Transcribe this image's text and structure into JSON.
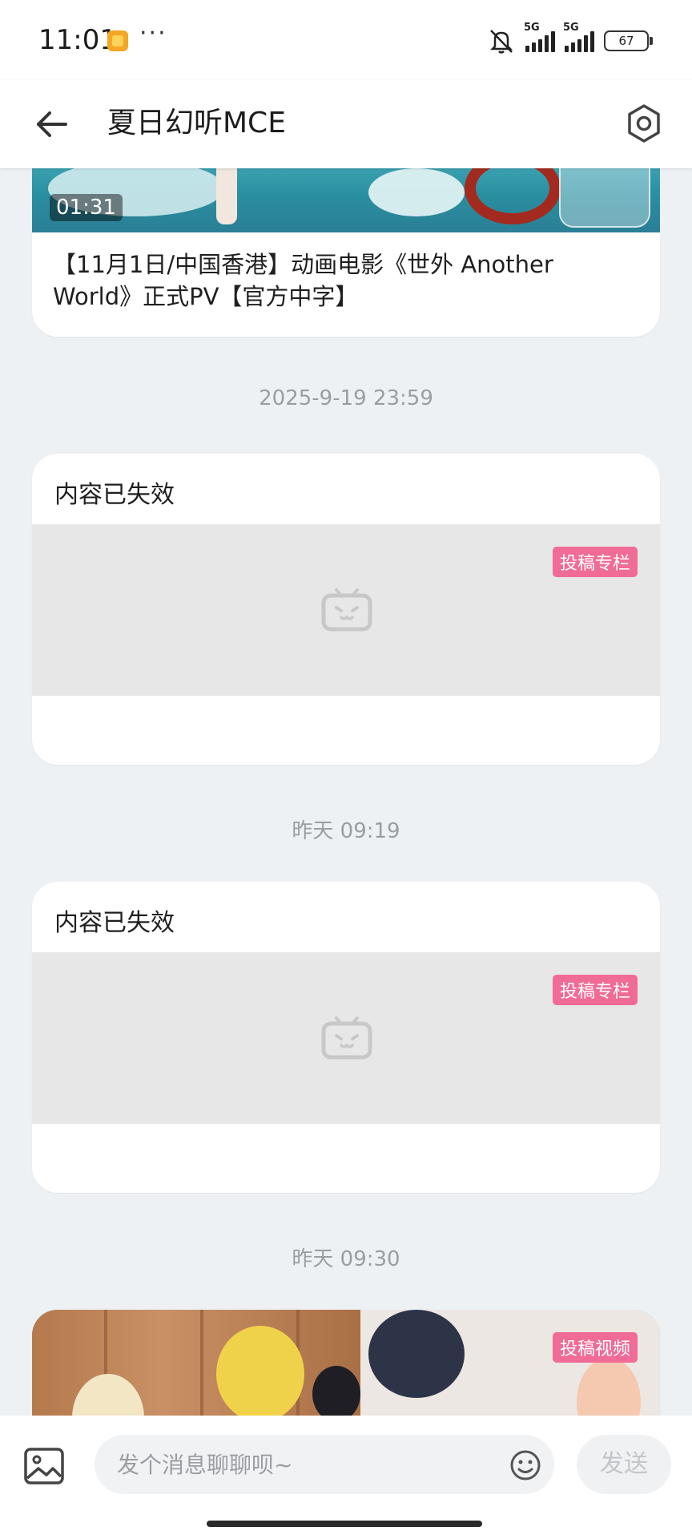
{
  "status_bar": {
    "time": "11:01",
    "dots": "···",
    "signal1": "5G",
    "signal2": "5G",
    "battery": "67"
  },
  "nav": {
    "title": "夏日幻听MCE",
    "back_icon": "arrow-left-icon",
    "settings_icon": "gear-icon"
  },
  "messages": [
    {
      "type": "video",
      "duration": "01:31",
      "title": "【11月1日/中国香港】动画电影《世外 Another World》正式PV【官方中字】"
    },
    {
      "type": "timestamp",
      "text": "2025-9-19 23:59"
    },
    {
      "type": "expired",
      "title": "内容已失效",
      "tag": "投稿专栏"
    },
    {
      "type": "timestamp",
      "text": "昨天 09:19"
    },
    {
      "type": "expired",
      "title": "内容已失效",
      "tag": "投稿专栏"
    },
    {
      "type": "timestamp",
      "text": "昨天 09:30"
    },
    {
      "type": "video",
      "tag": "投稿视频"
    }
  ],
  "input_bar": {
    "placeholder": "发个消息聊聊呗~",
    "send_label": "发送",
    "image_icon": "image-icon",
    "emoji_icon": "emoji-icon"
  },
  "colors": {
    "accent_pink": "#f06b96",
    "background": "#eef1f4"
  }
}
